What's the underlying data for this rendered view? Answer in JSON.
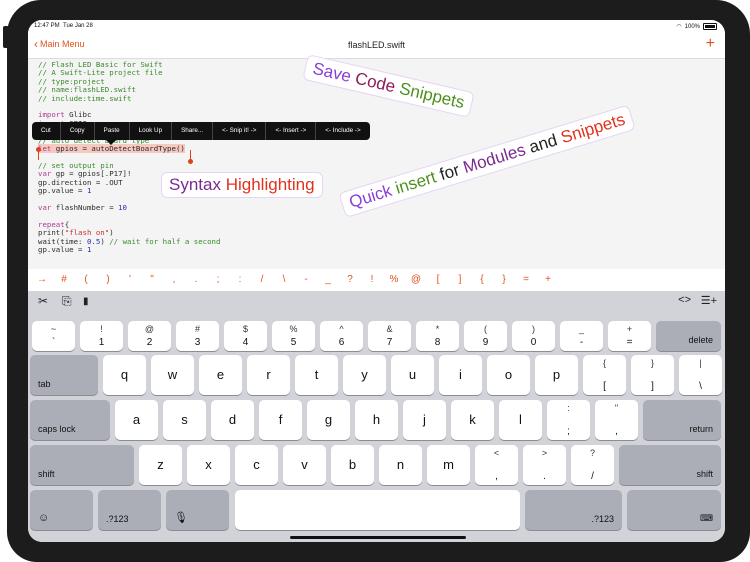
{
  "status_bar": {
    "time": "12:47 PM",
    "date": "Tue Jan 28",
    "battery": "100%"
  },
  "nav": {
    "back_label": "Main Menu",
    "title": "flashLED.swift",
    "add_icon": "plus-icon"
  },
  "code_lines": [
    "// Flash LED Basic for Swift",
    "// A Swift-Lite project file",
    "// type:project",
    "// name:flashLED.swift",
    "// include:time.swift",
    "",
    "import Glibc",
    "import GPIO",
    "",
    "// auto detect board type",
    "let gpios = autoDetectBoardType()",
    "",
    "// set output pin",
    "var gp = gpios[.P17]!",
    "gp.direction = .OUT",
    "gp.value = 1",
    "",
    "var flashNumber = 10",
    "",
    "repeat{",
    "print(\"flash on\")",
    "wait(time: 0.5) // wait for half a second",
    "gp.value = 1"
  ],
  "context_menu": [
    "Cut",
    "Copy",
    "Paste",
    "Look Up",
    "Share...",
    "<- Snip it! ->",
    "<- Insert ->",
    "<- Include ->"
  ],
  "callouts": {
    "save": [
      "Save",
      "Code",
      "Snippets"
    ],
    "syntax": [
      "Syntax",
      "Highlighting"
    ],
    "quick": [
      "Quick",
      "insert",
      "for",
      "Modules",
      "and",
      "Snippets"
    ]
  },
  "symbol_bar": [
    "→",
    "#",
    "(",
    ")",
    "'",
    "\"",
    ",",
    ".",
    ";",
    ":",
    "/",
    "\\",
    "-",
    "_",
    "?",
    "!",
    "%",
    "@",
    "[",
    "]",
    "{",
    "}",
    "=",
    "+"
  ],
  "keyboard": {
    "tools": {
      "cut": "✂",
      "copy": "⎘",
      "paste": "📋",
      "code": "<>",
      "list_add": "☰+"
    },
    "row1": [
      {
        "top": "~",
        "bot": "`"
      },
      {
        "top": "!",
        "bot": "1"
      },
      {
        "top": "@",
        "bot": "2"
      },
      {
        "top": "#",
        "bot": "3"
      },
      {
        "top": "$",
        "bot": "4"
      },
      {
        "top": "%",
        "bot": "5"
      },
      {
        "top": "^",
        "bot": "6"
      },
      {
        "top": "&",
        "bot": "7"
      },
      {
        "top": "*",
        "bot": "8"
      },
      {
        "top": "(",
        "bot": "9"
      },
      {
        "top": ")",
        "bot": "0"
      },
      {
        "top": "_",
        "bot": "-"
      },
      {
        "top": "+",
        "bot": "="
      }
    ],
    "delete": "delete",
    "tab": "tab",
    "row2": [
      "q",
      "w",
      "e",
      "r",
      "t",
      "y",
      "u",
      "i",
      "o",
      "p"
    ],
    "row2_sym": [
      {
        "top": "{",
        "bot": "["
      },
      {
        "top": "}",
        "bot": "]"
      },
      {
        "top": "|",
        "bot": "\\"
      }
    ],
    "caps": "caps lock",
    "row3": [
      "a",
      "s",
      "d",
      "f",
      "g",
      "h",
      "j",
      "k",
      "l"
    ],
    "row3_sym": [
      {
        "top": ":",
        "bot": ";"
      },
      {
        "top": "\"",
        "bot": ","
      }
    ],
    "return": "return",
    "shift": "shift",
    "row4": [
      "z",
      "x",
      "c",
      "v",
      "b",
      "n",
      "m"
    ],
    "row4_sym": [
      {
        "top": "<",
        "bot": ","
      },
      {
        "top": ">",
        "bot": "."
      },
      {
        "top": "?",
        "bot": "/"
      }
    ],
    "numbers": ".?123"
  }
}
